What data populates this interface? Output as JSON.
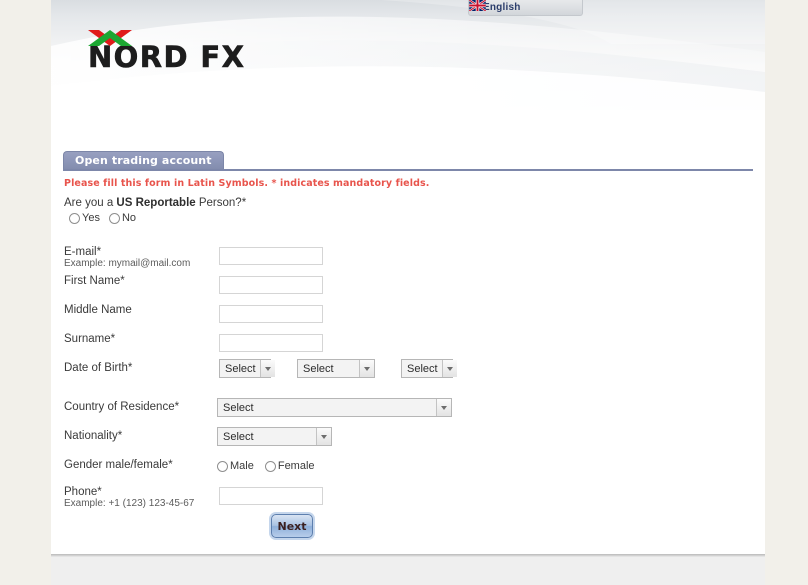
{
  "header": {
    "language_tab": {
      "label": "English",
      "flag_icon": "uk-flag-icon"
    },
    "logo": {
      "text": "NORD FX",
      "chevron_up_color": "#e01b1b",
      "chevron_down_color": "#1ca832"
    }
  },
  "form": {
    "tab_label": "Open trading account",
    "notice": "Please fill this form in Latin Symbols. * indicates mandatory fields.",
    "us_reportable": {
      "question_prefix": "Are you a ",
      "question_bold": "US Reportable",
      "question_suffix": " Person?*",
      "options": [
        {
          "label": "Yes"
        },
        {
          "label": "No"
        }
      ]
    },
    "fields": [
      {
        "label": "E-mail*",
        "hint": "Example: mymail@mail.com",
        "value": "",
        "type": "text"
      },
      {
        "label": "First Name*",
        "hint": "",
        "value": "",
        "type": "text"
      },
      {
        "label": "Middle Name",
        "hint": "",
        "value": "",
        "type": "text"
      },
      {
        "label": "Surname*",
        "hint": "",
        "value": "",
        "type": "text"
      },
      {
        "label": "Date of Birth*",
        "hint": "",
        "type": "date-selects"
      },
      {
        "label": "Country of Residence*",
        "hint": "",
        "type": "select-wide"
      },
      {
        "label": "Nationality*",
        "hint": "",
        "type": "select-nation"
      },
      {
        "label": "Gender male/female*",
        "hint": "",
        "type": "radios"
      },
      {
        "label": "Phone*",
        "hint": "Example: +1 (123) 123-45-67",
        "value": "",
        "type": "text"
      }
    ],
    "date_of_birth": {
      "day": "Select",
      "month": "Select",
      "year": "Select"
    },
    "country_of_residence": "Select",
    "nationality": "Select",
    "gender": {
      "options": [
        {
          "label": "Male"
        },
        {
          "label": "Female"
        }
      ]
    },
    "submit_label": "Next"
  },
  "colors": {
    "tab_blue": "#8d96b8",
    "notice_red": "#e8544c",
    "page_margin": "#f2f0ea"
  }
}
